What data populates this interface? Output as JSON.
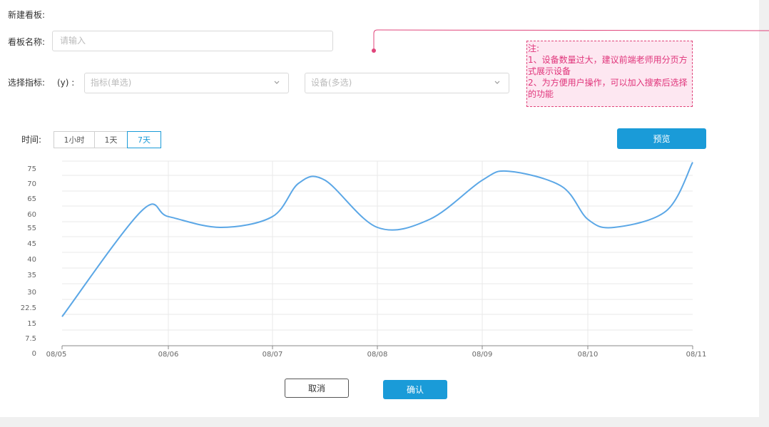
{
  "page": {
    "title": "新建看板:",
    "name_label": "看板名称:",
    "name_placeholder": "请输入",
    "metric_label": "选择指标:",
    "axis_label": "(y) :",
    "metric_select_placeholder": "指标(单选)",
    "device_select_placeholder": "设备(多选)",
    "time_label": "时间:",
    "time_options": [
      "1小时",
      "1天",
      "7天"
    ],
    "time_selected": "7天",
    "preview_button": "预览",
    "cancel_button": "取消",
    "confirm_button": "确认"
  },
  "annotation": {
    "line1": "注:",
    "line2": "1、设备数量过大，建议前端老师用分页方式展示设备",
    "line3": "2、为方便用户操作，可以加入搜索后选择的功能"
  },
  "colors": {
    "accent": "#1a9bd8",
    "line": "#5ba7e6",
    "note_border": "#e0457b",
    "note_bg": "#fde7f1"
  },
  "chart_data": {
    "type": "line",
    "x_ticks": [
      "08/05",
      "08/06",
      "08/07",
      "08/08",
      "08/09",
      "08/10",
      "08/11"
    ],
    "y_ticks": [
      "0",
      "7.5",
      "15",
      "22.5",
      "30",
      "35",
      "40",
      "45",
      "55",
      "60",
      "65",
      "70",
      "75"
    ],
    "series": [
      {
        "x": [
          "08/05",
          "08/05 18:00",
          "08/06",
          "08/06 12:00",
          "08/07",
          "08/07 06:00",
          "08/07 12:00",
          "08/08",
          "08/08 12:00",
          "08/09",
          "08/09 06:00",
          "08/09 18:00",
          "08/10",
          "08/10 06:00",
          "08/10 18:00",
          "08/11"
        ],
        "values": [
          18,
          61,
          59,
          55,
          59,
          70,
          71,
          55,
          58,
          71,
          74,
          69,
          58,
          55,
          61,
          77
        ]
      }
    ],
    "grid": true
  }
}
